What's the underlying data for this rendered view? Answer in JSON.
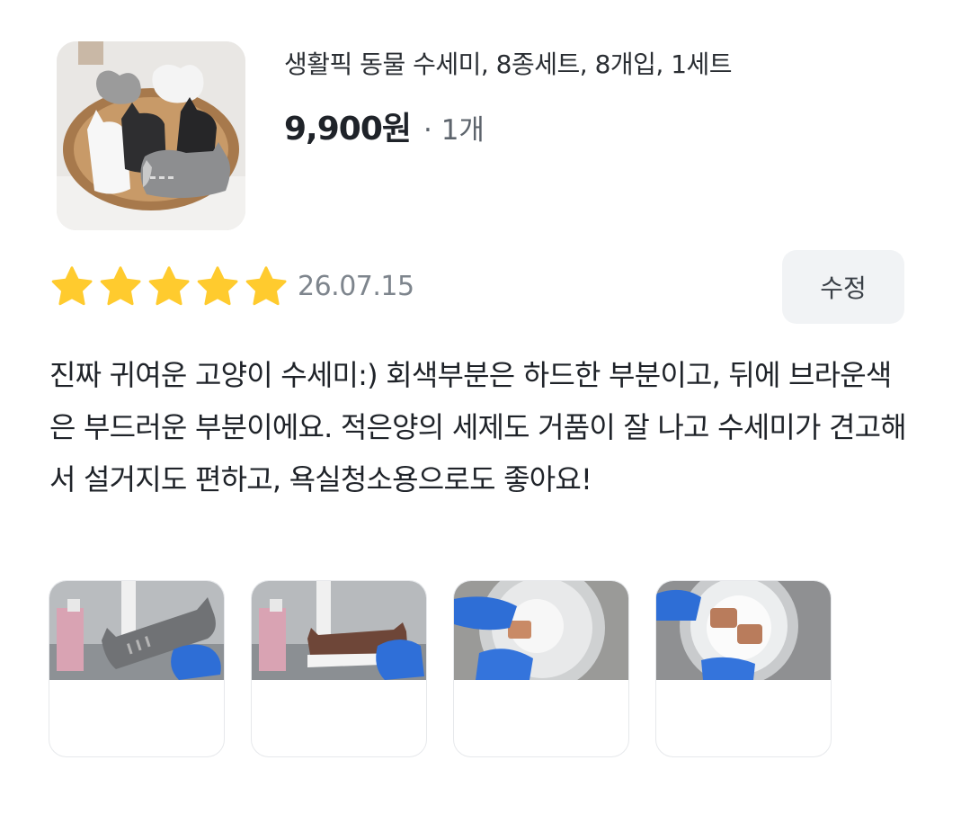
{
  "product": {
    "image_icon": "cat-sponge-basket-image",
    "name": "생활픽 동물 수세미, 8종세트, 8개입, 1세트",
    "price": "9,900원",
    "quantity": "· 1개"
  },
  "review": {
    "rating": 5,
    "rating_max": 5,
    "star_color": "#FFCB2E",
    "date": "26.07.15",
    "edit_label": "수정",
    "text": "진짜 귀여운 고양이 수세미:) 회색부분은 하드한 부분이고, 뒤에 브라운색은 부드러운 부분이에요. 적은양의 세제도 거품이 잘 나고 수세미가 견고해서 설거지도 편하고, 욕실청소용으로도 좋아요!"
  },
  "photos": [
    {
      "icon": "gray-cat-sponge-sink-photo"
    },
    {
      "icon": "brown-cat-sponge-sink-photo"
    },
    {
      "icon": "sponge-washing-bowl-photo"
    },
    {
      "icon": "foamy-bowl-photo"
    }
  ]
}
